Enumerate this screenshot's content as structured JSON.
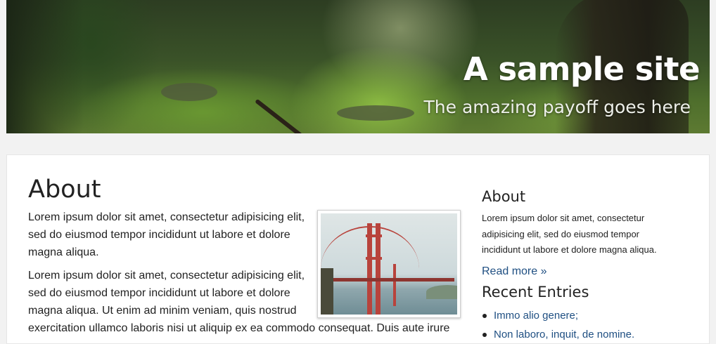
{
  "header": {
    "title": "A sample site",
    "payoff": "The amazing payoff goes here"
  },
  "main": {
    "heading": "About",
    "paragraph1": "Lorem ipsum dolor sit amet, consectetur adipisicing elit, sed do eiusmod tempor incididunt ut labore et dolore magna aliqua.",
    "paragraph2_lines": [
      "Lorem ipsum dolor sit amet, consectetur adipisicing elit,",
      "sed do eiusmod tempor incididunt ut labore et dolore",
      "magna aliqua. Ut enim ad minim veniam, quis nostrud",
      "exercitation ullamco laboris nisi ut aliquip ex ea commodo consequat. Duis aute irure"
    ],
    "image_subject": "golden-gate-bridge"
  },
  "sidebar": {
    "about_heading": "About",
    "about_text": "Lorem ipsum dolor sit amet, consectetur adipisicing elit, sed do eiusmod tempor incididunt ut labore et dolore magna aliqua.",
    "read_more": "Read more »",
    "recent_heading": "Recent Entries",
    "recent_entries": [
      "Immo alio genere;",
      "Non laboro, inquit, de nomine."
    ]
  },
  "colors": {
    "link": "#1f4f82",
    "panel_bg": "#ffffff",
    "page_bg": "#f2f2f2"
  }
}
